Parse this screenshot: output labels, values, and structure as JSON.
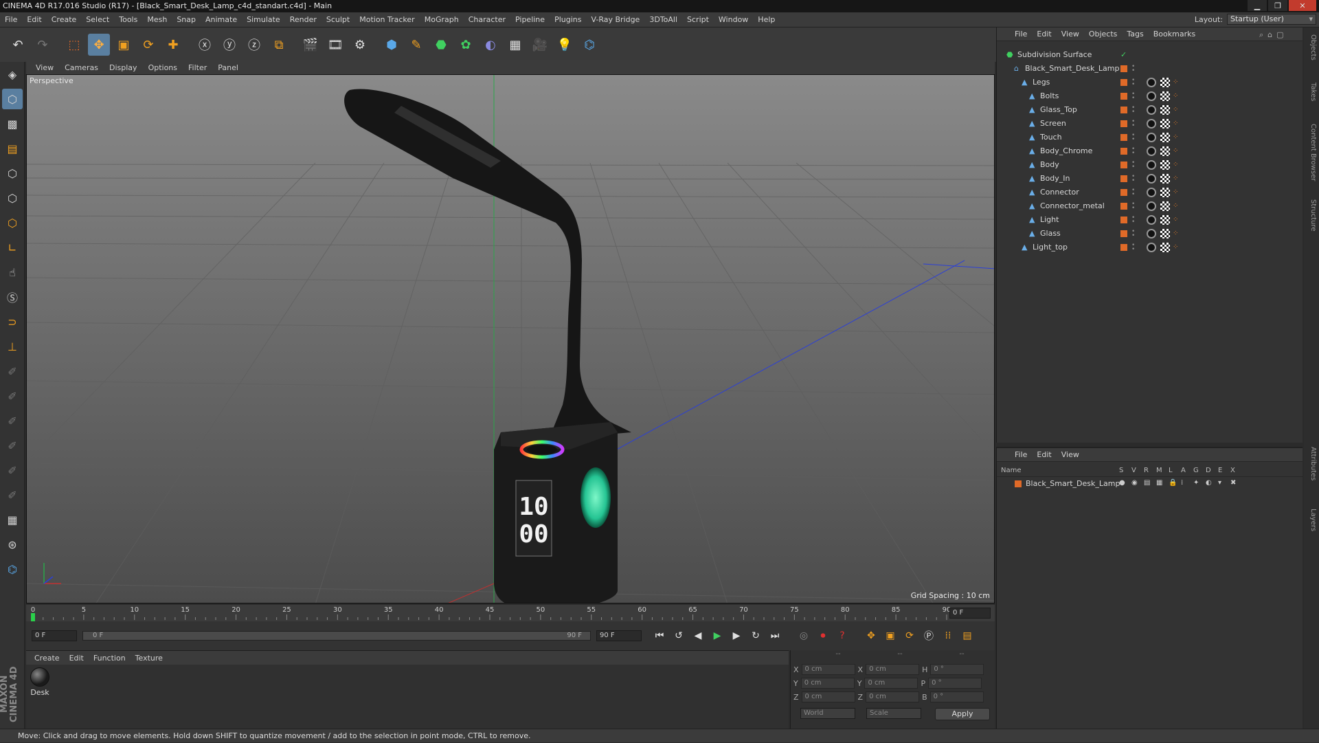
{
  "title_bar": {
    "text": "CINEMA 4D R17.016 Studio (R17) - [Black_Smart_Desk_Lamp_c4d_standart.c4d] - Main"
  },
  "menu": [
    "File",
    "Edit",
    "Create",
    "Select",
    "Tools",
    "Mesh",
    "Snap",
    "Animate",
    "Simulate",
    "Render",
    "Sculpt",
    "Motion Tracker",
    "MoGraph",
    "Character",
    "Pipeline",
    "Plugins",
    "V-Ray Bridge",
    "3DToAll",
    "Script",
    "Window",
    "Help"
  ],
  "layout": {
    "label": "Layout:",
    "value": "Startup (User)"
  },
  "viewport": {
    "menu": [
      "View",
      "Cameras",
      "Display",
      "Options",
      "Filter",
      "Panel"
    ],
    "label": "Perspective",
    "grid_spacing": "Grid Spacing : 10 cm",
    "clock": {
      "hh": "10",
      "mm": "00"
    }
  },
  "timeline": {
    "ticks": [
      "0",
      "5",
      "10",
      "15",
      "20",
      "25",
      "30",
      "35",
      "40",
      "45",
      "50",
      "55",
      "60",
      "65",
      "70",
      "75",
      "80",
      "85",
      "90"
    ],
    "current_frame": "0 F",
    "start": "0 F",
    "range_start": "0 F",
    "range_end": "90 F",
    "end": "90 F"
  },
  "material_panel": {
    "menu": [
      "Create",
      "Edit",
      "Function",
      "Texture"
    ],
    "material_name": "Desk"
  },
  "coords": {
    "headers": [
      "--",
      "--",
      "--"
    ],
    "rows": [
      {
        "a": "X",
        "av": "0 cm",
        "b": "X",
        "bv": "0 cm",
        "c": "H",
        "cv": "0 °"
      },
      {
        "a": "Y",
        "av": "0 cm",
        "b": "Y",
        "bv": "0 cm",
        "c": "P",
        "cv": "0 °"
      },
      {
        "a": "Z",
        "av": "0 cm",
        "b": "Z",
        "bv": "0 cm",
        "c": "B",
        "cv": "0 °"
      }
    ],
    "mode1": "World",
    "mode2": "Scale",
    "apply": "Apply"
  },
  "object_manager": {
    "menu": [
      "File",
      "Edit",
      "View",
      "Objects",
      "Tags",
      "Bookmarks"
    ],
    "objects": [
      {
        "name": "Subdivision Surface",
        "indent": 0,
        "root": true
      },
      {
        "name": "Black_Smart_Desk_Lamp",
        "indent": 1
      },
      {
        "name": "Legs",
        "indent": 2
      },
      {
        "name": "Bolts",
        "indent": 3
      },
      {
        "name": "Glass_Top",
        "indent": 3
      },
      {
        "name": "Screen",
        "indent": 3
      },
      {
        "name": "Touch",
        "indent": 3
      },
      {
        "name": "Body_Chrome",
        "indent": 3
      },
      {
        "name": "Body",
        "indent": 3
      },
      {
        "name": "Body_In",
        "indent": 3
      },
      {
        "name": "Connector",
        "indent": 3
      },
      {
        "name": "Connector_metal",
        "indent": 3
      },
      {
        "name": "Light",
        "indent": 3
      },
      {
        "name": "Glass",
        "indent": 3
      },
      {
        "name": "Light_top",
        "indent": 2
      }
    ]
  },
  "layers": {
    "menu": [
      "File",
      "Edit",
      "View"
    ],
    "columns": [
      "Name",
      "S",
      "V",
      "R",
      "M",
      "L",
      "A",
      "G",
      "D",
      "E",
      "X"
    ],
    "rows": [
      {
        "name": "Black_Smart_Desk_Lamp"
      }
    ]
  },
  "right_tabs": [
    "Objects",
    "Takes",
    "Content Browser",
    "Structure",
    "Attributes",
    "Layers"
  ],
  "status": "Move: Click and drag to move elements. Hold down SHIFT to quantize movement / add to the selection in point mode, CTRL to remove."
}
